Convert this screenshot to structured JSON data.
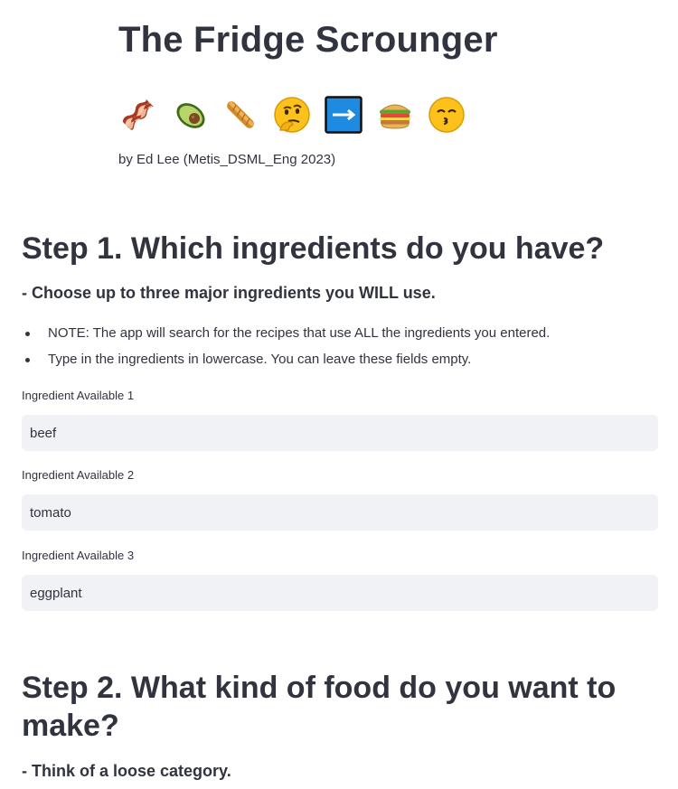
{
  "header": {
    "title": "The Fridge Scrounger",
    "byline": "by Ed Lee (Metis_DSML_Eng 2023)",
    "emojis": [
      "bacon",
      "avocado",
      "baguette-bread",
      "thinking-face",
      "right-arrow",
      "sandwich",
      "kissing-face-with-smiling-eyes"
    ]
  },
  "step1": {
    "heading": "Step 1. Which ingredients do you have?",
    "subheading": "- Choose up to three major ingredients you WILL use.",
    "notes": [
      "NOTE: The app will search for the recipes that use ALL the ingredients you entered.",
      "Type in the ingredients in lowercase. You can leave these fields empty."
    ],
    "fields": [
      {
        "label": "Ingredient Available 1",
        "value": "beef"
      },
      {
        "label": "Ingredient Available 2",
        "value": "tomato"
      },
      {
        "label": "Ingredient Available 3",
        "value": "eggplant"
      }
    ]
  },
  "step2": {
    "heading_line1": "Step 2. What kind of food do you want to",
    "heading_line2": "make?",
    "subheading": "- Think of a loose category."
  },
  "colors": {
    "text": "#31333f",
    "input_bg": "#f0f2f6"
  }
}
